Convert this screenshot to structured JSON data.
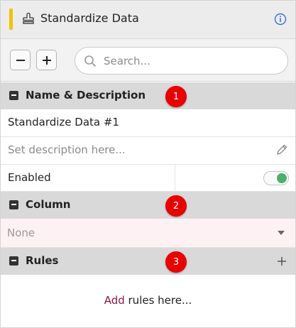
{
  "header": {
    "title": "Standardize Data",
    "accent_color": "#f2c200",
    "icon": "stamp-icon",
    "info_icon": "info-icon"
  },
  "toolbar": {
    "collapse_all_icon": "minus-icon",
    "expand_all_icon": "plus-icon",
    "search": {
      "placeholder": "Search...",
      "value": ""
    }
  },
  "sections": {
    "name_description": {
      "title": "Name & Description",
      "badge": "1",
      "name_value": "Standardize Data #1",
      "description_placeholder": "Set description here...",
      "enabled_label": "Enabled",
      "enabled": true
    },
    "column": {
      "title": "Column",
      "badge": "2",
      "selected": "None"
    },
    "rules": {
      "title": "Rules",
      "badge": "3",
      "empty_link": "Add",
      "empty_text": " rules here..."
    }
  },
  "colors": {
    "badge": "#e80000",
    "toggle_on": "#4caf6e",
    "link": "#8b1a3c"
  }
}
